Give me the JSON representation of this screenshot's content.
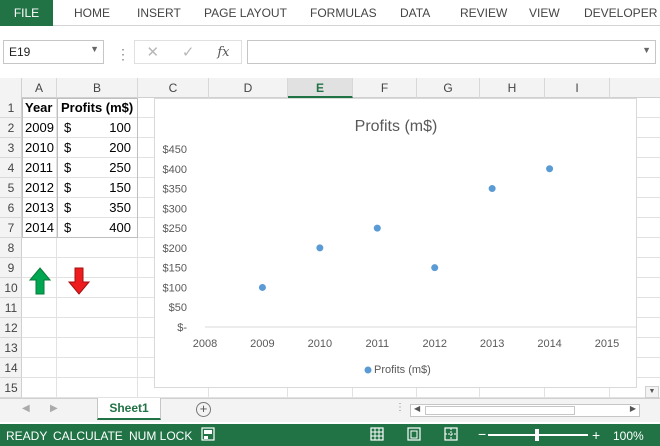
{
  "ribbon": {
    "file": "FILE",
    "tabs": [
      "HOME",
      "INSERT",
      "PAGE LAYOUT",
      "FORMULAS",
      "DATA",
      "REVIEW",
      "VIEW",
      "DEVELOPER"
    ]
  },
  "formula_bar": {
    "name_box": "E19",
    "cancel_glyph": "✕",
    "enter_glyph": "✓",
    "fx": "fx",
    "formula": ""
  },
  "columns": [
    "A",
    "B",
    "C",
    "D",
    "E",
    "F",
    "G",
    "H",
    "I"
  ],
  "active_column": "E",
  "rows": [
    "1",
    "2",
    "3",
    "4",
    "5",
    "6",
    "7",
    "8",
    "9",
    "10",
    "11",
    "12",
    "13",
    "14",
    "15"
  ],
  "table": {
    "headers": [
      "Year",
      "Profits (m$)"
    ],
    "currency": "$",
    "rows": [
      {
        "year": "2009",
        "profit": "100"
      },
      {
        "year": "2010",
        "profit": "200"
      },
      {
        "year": "2011",
        "profit": "250"
      },
      {
        "year": "2012",
        "profit": "150"
      },
      {
        "year": "2013",
        "profit": "350"
      },
      {
        "year": "2014",
        "profit": "400"
      }
    ]
  },
  "arrows": {
    "up_color": "#00a651",
    "down_color": "#ee1c1c"
  },
  "chart_data": {
    "type": "scatter",
    "title": "Profits (m$)",
    "x": [
      2009,
      2010,
      2011,
      2012,
      2013,
      2014
    ],
    "y": [
      100,
      200,
      250,
      150,
      350,
      400
    ],
    "series": [
      {
        "name": "Profits (m$)",
        "values": [
          100,
          200,
          250,
          150,
          350,
          400
        ]
      }
    ],
    "xlim": [
      2008,
      2015
    ],
    "ylim": [
      0,
      450
    ],
    "xticks": [
      "2008",
      "2009",
      "2010",
      "2011",
      "2012",
      "2013",
      "2014",
      "2015"
    ],
    "yticks": [
      "$-",
      "$50",
      "$100",
      "$150",
      "$200",
      "$250",
      "$300",
      "$350",
      "$400",
      "$450"
    ],
    "grid": false,
    "legend": "bottom",
    "marker_color": "#5b9bd5"
  },
  "sheets": {
    "active": "Sheet1"
  },
  "status": {
    "ready": "READY",
    "calculate": "CALCULATE",
    "num_lock": "NUM LOCK",
    "zoom": "100%",
    "minus": "−",
    "plus": "+"
  },
  "accent": "#217346"
}
